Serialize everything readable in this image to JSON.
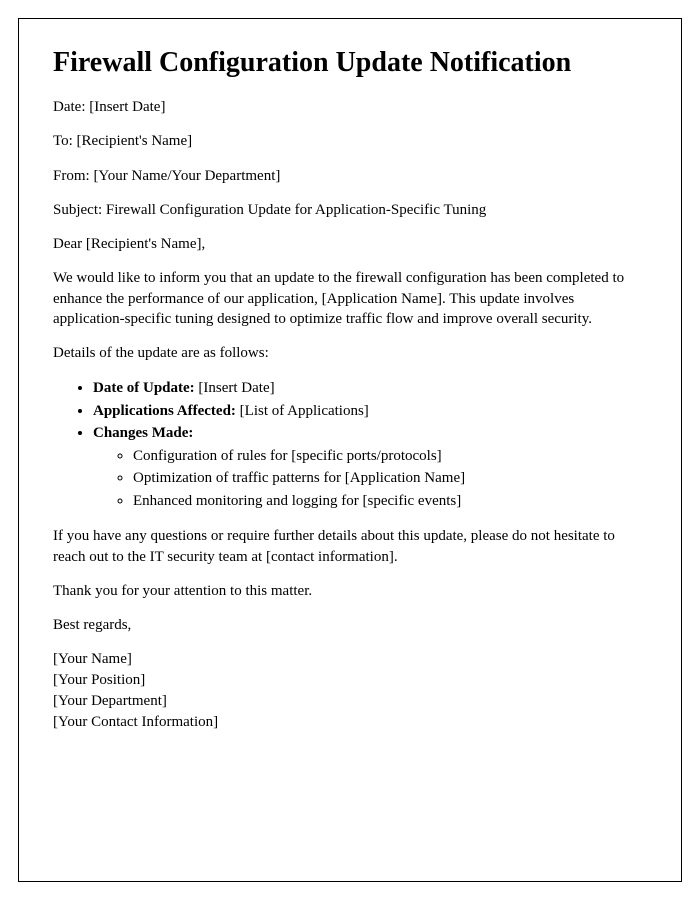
{
  "title": "Firewall Configuration Update Notification",
  "meta": {
    "date_label": "Date: ",
    "date_value": "[Insert Date]",
    "to_label": "To: ",
    "to_value": "[Recipient's Name]",
    "from_label": "From: ",
    "from_value": "[Your Name/Your Department]",
    "subject_label": "Subject: ",
    "subject_value": "Firewall Configuration Update for Application-Specific Tuning"
  },
  "salutation": "Dear [Recipient's Name],",
  "body": {
    "intro": "We would like to inform you that an update to the firewall configuration has been completed to enhance the performance of our application, [Application Name]. This update involves application-specific tuning designed to optimize traffic flow and improve overall security.",
    "details_lead": "Details of the update are as follows:",
    "details": {
      "date_label": "Date of Update:",
      "date_value": " [Insert Date]",
      "apps_label": "Applications Affected:",
      "apps_value": " [List of Applications]",
      "changes_label": "Changes Made:",
      "changes": [
        "Configuration of rules for [specific ports/protocols]",
        "Optimization of traffic patterns for [Application Name]",
        "Enhanced monitoring and logging for [specific events]"
      ]
    },
    "closing_help": "If you have any questions or require further details about this update, please do not hesitate to reach out to the IT security team at [contact information].",
    "thanks": "Thank you for your attention to this matter.",
    "signoff": "Best regards,"
  },
  "signature": {
    "name": "[Your Name]",
    "position": "[Your Position]",
    "department": "[Your Department]",
    "contact": "[Your Contact Information]"
  }
}
